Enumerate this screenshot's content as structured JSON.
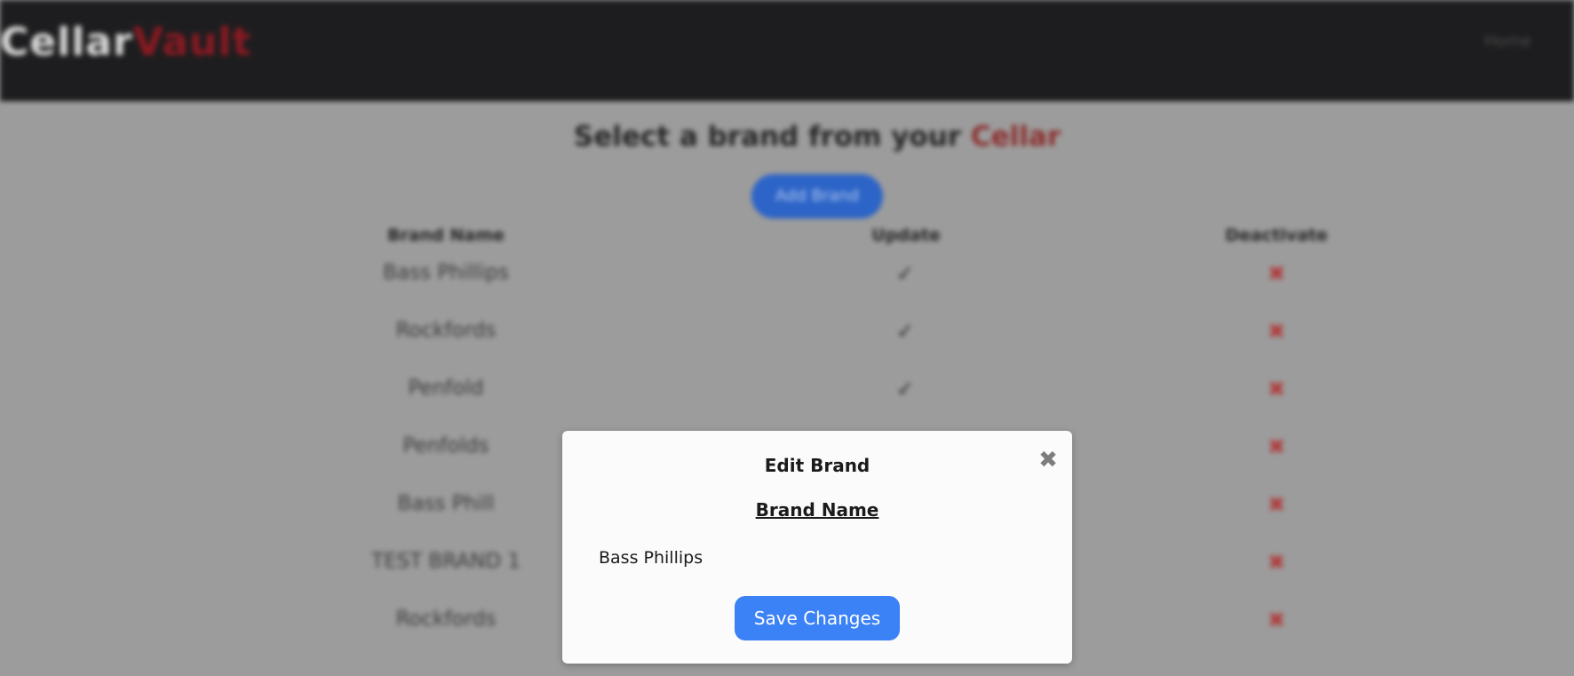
{
  "app": {
    "logo_part1": "Cellar",
    "logo_part2": "Vault",
    "nav_link": "Home"
  },
  "page": {
    "heading_prefix": "Select a brand from your",
    "heading_accent": "Cellar",
    "add_brand_label": "Add Brand"
  },
  "table": {
    "columns": [
      "Brand Name",
      "Update",
      "Deactivate"
    ],
    "rows": [
      {
        "name": "Bass Phillips",
        "update_icon": "✓",
        "delete_icon": "✖"
      },
      {
        "name": "Rockfords",
        "update_icon": "✓",
        "delete_icon": "✖"
      },
      {
        "name": "Penfold",
        "update_icon": "✓",
        "delete_icon": "✖"
      },
      {
        "name": "Penfolds",
        "update_icon": "",
        "delete_icon": "✖"
      },
      {
        "name": "Bass Phill",
        "update_icon": "",
        "delete_icon": "✖"
      },
      {
        "name": "TEST BRAND 1",
        "update_icon": "",
        "delete_icon": "✖"
      },
      {
        "name": "Rockfords",
        "update_icon": "",
        "delete_icon": "✖"
      }
    ]
  },
  "modal": {
    "title": "Edit Brand",
    "close_icon": "✖",
    "field_label": "Brand Name",
    "field_value": "Bass Phillips",
    "save_label": "Save Changes"
  },
  "colors": {
    "navbar": "#1d1d1f",
    "accent_red": "#8a1a22",
    "primary_blue": "#3b82f6",
    "overlay_gray": "#9c9c9c"
  },
  "icons": {
    "update": "edit-check-icon",
    "delete": "x-circle-icon",
    "close": "close-icon"
  }
}
